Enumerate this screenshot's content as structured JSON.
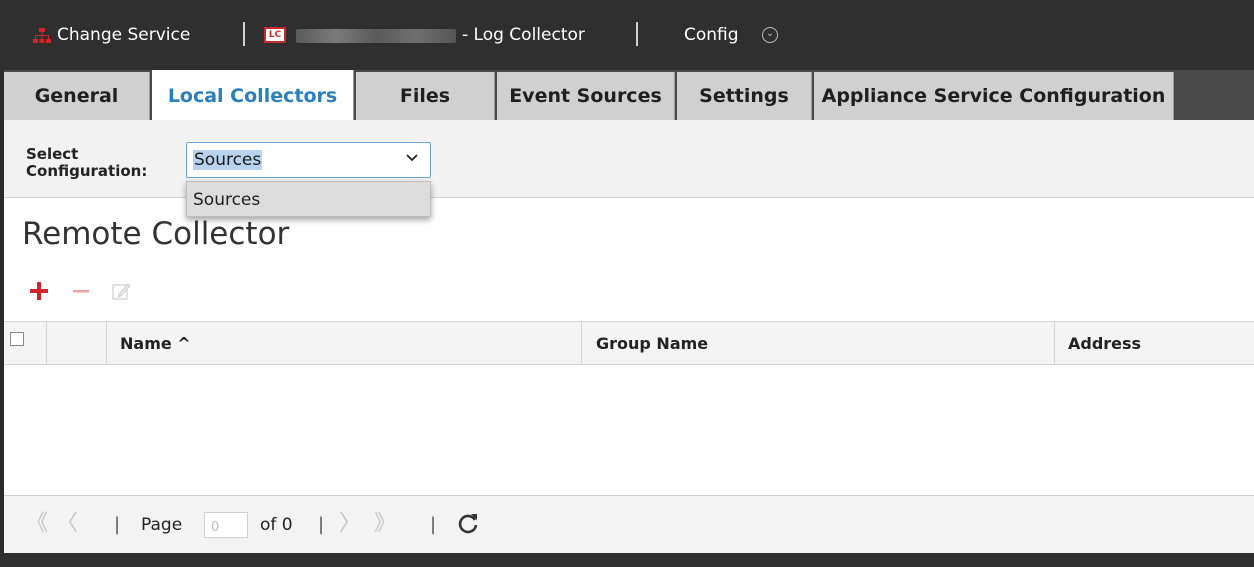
{
  "header": {
    "change_service": "Change Service",
    "lc_badge": "LC",
    "service_name_suffix": "- Log Collector",
    "config_menu": "Config",
    "icons": [
      "network-tree-icon",
      "log-collector-badge-icon",
      "chevron-down-circle-icon"
    ]
  },
  "tabs": [
    {
      "label": "General",
      "active": false
    },
    {
      "label": "Local Collectors",
      "active": true
    },
    {
      "label": "Files",
      "active": false
    },
    {
      "label": "Event Sources",
      "active": false
    },
    {
      "label": "Settings",
      "active": false
    },
    {
      "label": "Appliance Service Configuration",
      "active": false
    }
  ],
  "config": {
    "label_line1": "Select",
    "label_line2": "Configuration:",
    "selected": "Sources",
    "options": [
      "Sources"
    ]
  },
  "section": {
    "title": "Remote Collector",
    "toolbar_icons": [
      "add-icon",
      "remove-icon",
      "edit-icon"
    ]
  },
  "grid": {
    "columns": [
      "Name ^",
      "Group Name",
      "Address"
    ],
    "rows": []
  },
  "pager": {
    "page_label": "Page",
    "page_value": "0",
    "of_label": "of 0",
    "icons": [
      "first-page-icon",
      "prev-page-icon",
      "next-page-icon",
      "last-page-icon",
      "refresh-icon"
    ]
  },
  "colors": {
    "header_bg": "#2f2f2f",
    "active_tab_text": "#2a7fbf",
    "accent_red": "#d0252a"
  }
}
